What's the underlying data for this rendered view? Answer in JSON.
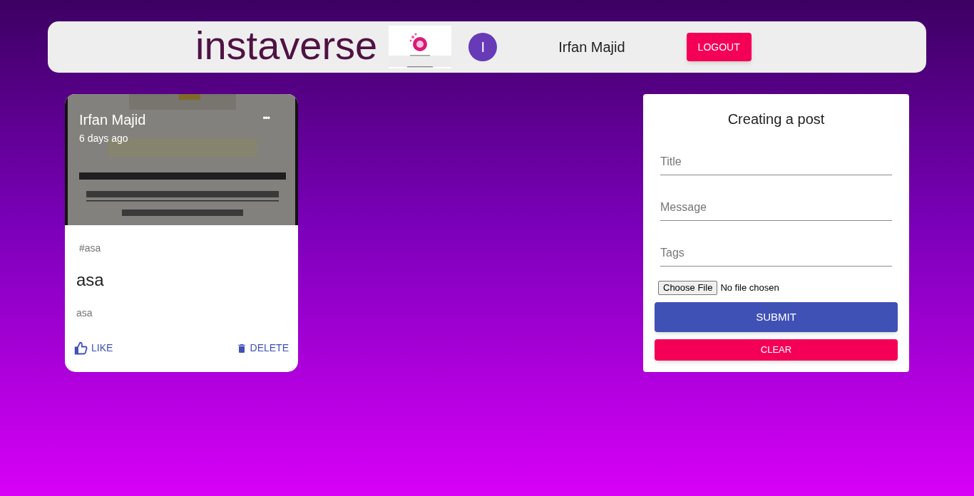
{
  "header": {
    "brand": "instaverse",
    "avatar_initial": "I",
    "user_name": "Irfan Majid",
    "logout": "LOGOUT"
  },
  "posts": [
    {
      "author": "Irfan Majid",
      "time": "6 days ago",
      "more": "•••",
      "tags": "#asa",
      "title": "asa",
      "message": "asa",
      "like": "LIKE",
      "delete": "DELETE"
    }
  ],
  "form": {
    "title": "Creating a post",
    "fields": [
      {
        "placeholder": "Title"
      },
      {
        "placeholder": "Message"
      },
      {
        "placeholder": "Tags"
      }
    ],
    "file_button": "Choose File",
    "file_status": "No file chosen",
    "submit": "SUBMIT",
    "clear": "CLEAR"
  }
}
